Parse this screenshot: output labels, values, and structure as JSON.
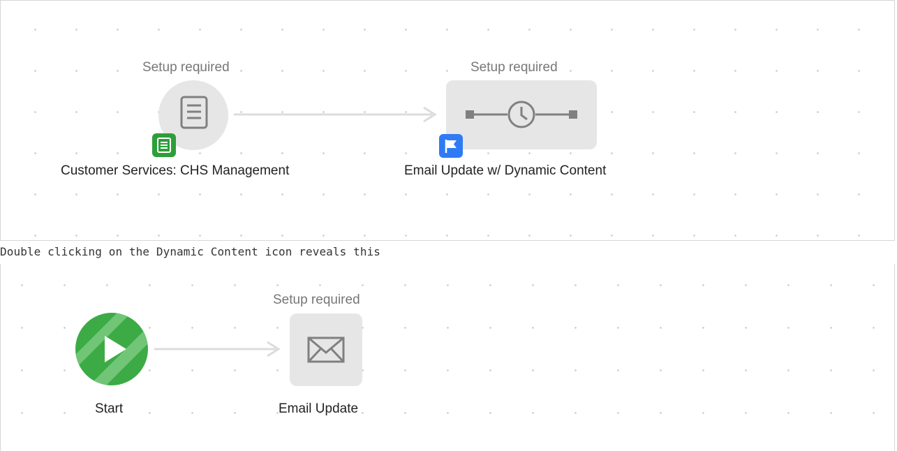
{
  "flow_top": {
    "node_1": {
      "status": "Setup required",
      "label": "Customer Services: CHS Management",
      "icon": "form-icon",
      "badge_icon": "form-badge-icon",
      "badge_color": "#2e9e3a"
    },
    "node_2": {
      "status": "Setup required",
      "label": "Email Update w/ Dynamic Content",
      "icon": "wait-timer-icon",
      "badge_icon": "flag-badge-icon",
      "badge_color": "#2f7bf5"
    }
  },
  "caption": "Double clicking on the Dynamic Content icon reveals this",
  "flow_bottom": {
    "start": {
      "label": "Start",
      "icon": "play-icon",
      "color": "#3cab45"
    },
    "email": {
      "status": "Setup required",
      "label": "Email Update",
      "icon": "envelope-icon"
    }
  },
  "colors": {
    "node_bg": "#e6e6e6",
    "connector": "#dcdcdc",
    "icon_stroke": "#808080"
  }
}
